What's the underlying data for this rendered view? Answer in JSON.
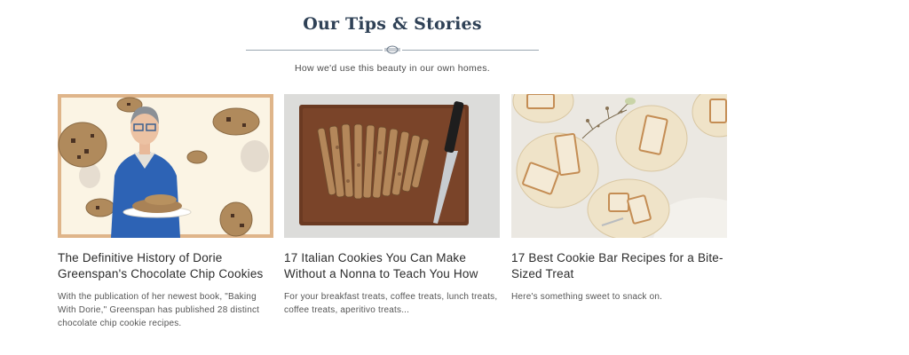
{
  "section": {
    "title": "Our Tips & Stories",
    "subtitle": "How we'd use this beauty in our own homes."
  },
  "cards": [
    {
      "title": "The Definitive History of Dorie Greenspan's Chocolate Chip Cookies",
      "description": "With the publication of her newest book, \"Baking With Dorie,\" Greenspan has published 28 distinct chocolate chip cookie recipes.",
      "image": "woman-holding-cookies-photo"
    },
    {
      "title": "17 Italian Cookies You Can Make Without a Nonna to Teach You How",
      "description": "For your breakfast treats, coffee treats, lunch treats, coffee treats, aperitivo treats...",
      "image": "biscotti-cutting-board-photo"
    },
    {
      "title": "17 Best Cookie Bar Recipes for a Bite-Sized Treat",
      "description": "Here's something sweet to snack on.",
      "image": "cookie-bars-plates-photo"
    }
  ]
}
